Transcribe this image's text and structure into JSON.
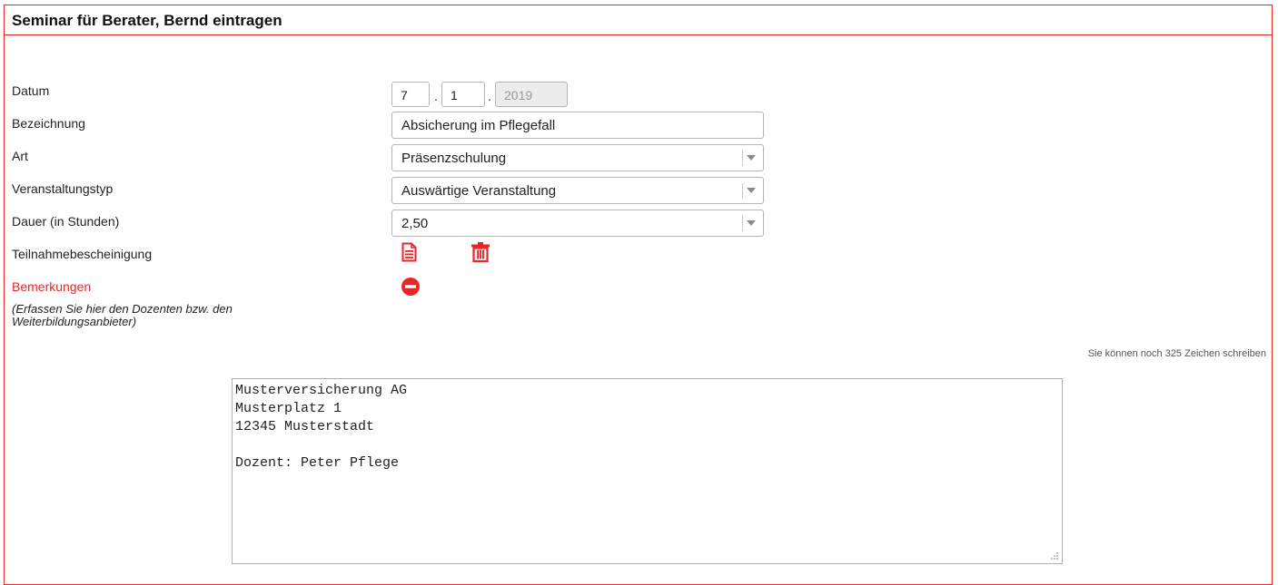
{
  "header": {
    "title": "Seminar für Berater, Bernd eintragen"
  },
  "form": {
    "datum": {
      "label": "Datum",
      "day": "7",
      "month": "1",
      "year": "2019",
      "separator": "."
    },
    "bezeichnung": {
      "label": "Bezeichnung",
      "value": "Absicherung im Pflegefall"
    },
    "art": {
      "label": "Art",
      "value": "Präsenzschulung"
    },
    "veranstaltungstyp": {
      "label": "Veranstaltungstyp",
      "value": "Auswärtige Veranstaltung"
    },
    "dauer": {
      "label": "Dauer (in Stunden)",
      "value": "2,50"
    },
    "teilnahme": {
      "label": "Teilnahmebescheinigung",
      "document_icon": "document-icon",
      "delete_icon": "trash-icon"
    },
    "bemerkungen": {
      "label": "Bemerkungen",
      "hint": "(Erfassen Sie hier den Dozenten bzw. den Weiterbildungsanbieter)",
      "remove_icon": "minus-circle-icon",
      "counter": "Sie können noch 325 Zeichen schreiben",
      "text": "Musterversicherung AG\nMusterplatz 1\n12345 Musterstadt\n\nDozent: Peter Pflege"
    }
  },
  "colors": {
    "accent": "#e8262a",
    "border": "#b5b5b5",
    "disabled_bg": "#ececec"
  }
}
